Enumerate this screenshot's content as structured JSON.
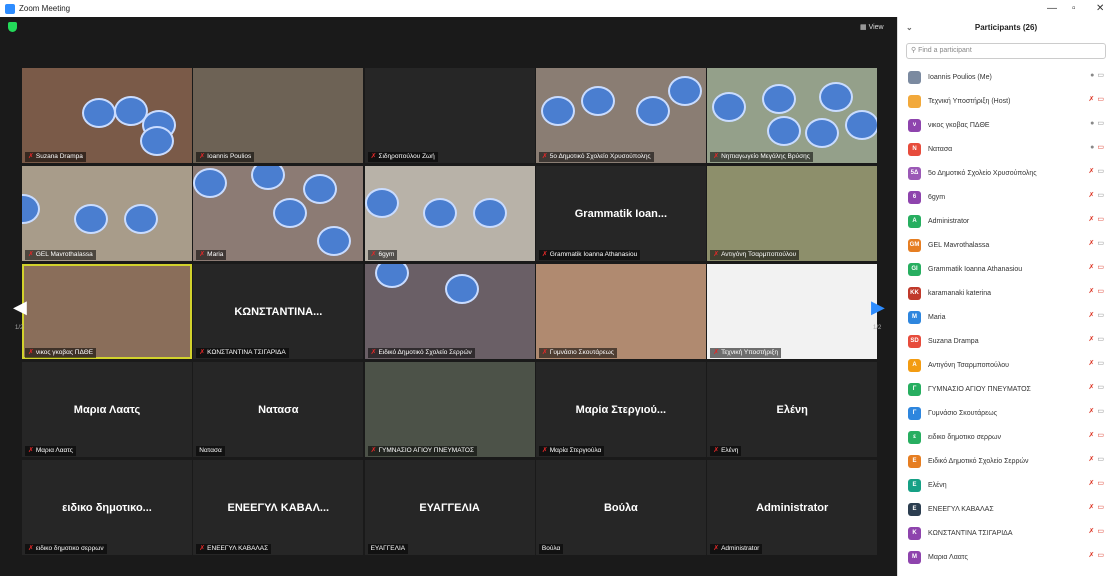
{
  "window": {
    "title": "Zoom Meeting",
    "minimize": "—",
    "maximize": "▫",
    "close": "✕"
  },
  "toolbar": {
    "view_label": "View"
  },
  "pager": {
    "left": "1/2",
    "right": "1/2"
  },
  "tiles": [
    {
      "name": "Suzana Drampa",
      "big": "",
      "video": true,
      "bg": "#7a5a48"
    },
    {
      "name": "Ioannis Poulios",
      "big": "",
      "video": true,
      "bg": "#6d6255"
    },
    {
      "name": "Σιδηροπούλου Ζωή",
      "big": "",
      "video": false,
      "bg": "#262626"
    },
    {
      "name": "5ο Δημοτικό Σχολείο Χρυσούπολης",
      "big": "",
      "video": true,
      "bg": "#8a7d73"
    },
    {
      "name": "Νηπιαγωγείο Μεγάλης Βρύσης",
      "big": "",
      "video": true,
      "bg": "#94a08a"
    },
    {
      "name": "GEL Mavrothalassa",
      "big": "",
      "video": true,
      "bg": "#a89c8a"
    },
    {
      "name": "Maria",
      "big": "",
      "video": true,
      "bg": "#8c7b74"
    },
    {
      "name": "6gym",
      "big": "",
      "video": true,
      "bg": "#b8b2a8"
    },
    {
      "name": "Grammatik Ioanna Athanasiou",
      "big": "Grammatik Ioan...",
      "video": false,
      "bg": "#262626"
    },
    {
      "name": "Αντιγόνη Τσαρμποπούλου",
      "big": "",
      "video": true,
      "bg": "#8d8f6b"
    },
    {
      "name": "νικος γκοβας ΠΔΘΕ",
      "big": "",
      "video": true,
      "bg": "#8a6e5a"
    },
    {
      "name": "ΚΩΝΣΤΑΝΤΙΝΑ ΤΣΙΓΑΡΙΔΑ",
      "big": "ΚΩΝΣΤΑΝΤΙΝΑ...",
      "video": false,
      "bg": "#262626"
    },
    {
      "name": "Ειδικό Δημοτικό Σχολείο Σερρών",
      "big": "",
      "video": true,
      "bg": "#6a5f66"
    },
    {
      "name": "Γυμνάσιο Σκουτάρεως",
      "big": "",
      "video": true,
      "bg": "#b08a70"
    },
    {
      "name": "Τεχνική Υποστήριξη",
      "big": "",
      "video": true,
      "bg": "#f2f2f2"
    },
    {
      "name": "Μαρια Λαατς",
      "big": "Μαρια Λαατς",
      "video": false,
      "bg": "#262626"
    },
    {
      "name": "Νατασα",
      "big": "Νατασα",
      "video": false,
      "bg": "#262626"
    },
    {
      "name": "ΓΥΜΝΑΣΙΟ ΑΓΙΟΥ ΠΝΕΥΜΑΤΟΣ",
      "big": "",
      "video": true,
      "bg": "#4c5248"
    },
    {
      "name": "Μαρία Στεργιούλα",
      "big": "Μαρία Στεργιού...",
      "video": false,
      "bg": "#262626"
    },
    {
      "name": "Ελένη",
      "big": "Ελένη",
      "video": false,
      "bg": "#262626"
    },
    {
      "name": "ειδικο δημοτικο σερρων",
      "big": "ειδικο δημοτικο...",
      "video": false,
      "bg": "#262626"
    },
    {
      "name": "ΕΝΕΕΓΥΛ ΚΑΒΑΛΑΣ",
      "big": "ΕΝΕΕΓΥΛ ΚΑΒΑΛ...",
      "video": false,
      "bg": "#262626"
    },
    {
      "name": "ΕΥΑΓΓΕΛΙΑ",
      "big": "ΕΥΑΓΓΕΛΙΑ",
      "video": false,
      "bg": "#262626"
    },
    {
      "name": "Βούλα",
      "big": "Βούλα",
      "video": false,
      "bg": "#262626"
    },
    {
      "name": "Administrator",
      "big": "Administrator",
      "video": false,
      "bg": "#262626"
    }
  ],
  "participants_panel": {
    "title": "Participants (26)",
    "search_placeholder": "Find a participant",
    "items": [
      {
        "name": "Ioannis Poulios (Me)",
        "initials": "",
        "color": "#7b8aa0",
        "muted": false,
        "video": true
      },
      {
        "name": "Τεχνική Υποστήριξη (Host)",
        "initials": "",
        "color": "#f2a93b",
        "muted": true,
        "video": false
      },
      {
        "name": "νικος γκοβας ΠΔΘΕ",
        "initials": "ν",
        "color": "#8e44ad",
        "muted": false,
        "video": true
      },
      {
        "name": "Νατασα",
        "initials": "N",
        "color": "#e74c3c",
        "muted": false,
        "video": false
      },
      {
        "name": "5ο Δημοτικό Σχολείο Χρυσούπολης",
        "initials": "5Δ",
        "color": "#9b59b6",
        "muted": true,
        "video": true
      },
      {
        "name": "6gym",
        "initials": "6",
        "color": "#8e44ad",
        "muted": true,
        "video": true
      },
      {
        "name": "Administrator",
        "initials": "A",
        "color": "#27ae60",
        "muted": true,
        "video": false
      },
      {
        "name": "GEL Mavrothalassa",
        "initials": "GM",
        "color": "#e67e22",
        "muted": true,
        "video": true
      },
      {
        "name": "Grammatik Ioanna Athanasiou",
        "initials": "GI",
        "color": "#27ae60",
        "muted": true,
        "video": false
      },
      {
        "name": "karamanaki katerina",
        "initials": "KK",
        "color": "#c0392b",
        "muted": true,
        "video": false
      },
      {
        "name": "Maria",
        "initials": "M",
        "color": "#2e86de",
        "muted": true,
        "video": true
      },
      {
        "name": "Suzana Drampa",
        "initials": "SD",
        "color": "#e74c3c",
        "muted": true,
        "video": true
      },
      {
        "name": "Αντιγόνη Τσαρμποπούλου",
        "initials": "A",
        "color": "#f39c12",
        "muted": true,
        "video": true
      },
      {
        "name": "ΓΥΜΝΑΣΙΟ ΑΓΙΟΥ ΠΝΕΥΜΑΤΟΣ",
        "initials": "Γ",
        "color": "#27ae60",
        "muted": true,
        "video": true
      },
      {
        "name": "Γυμνάσιο Σκουτάρεως",
        "initials": "Γ",
        "color": "#2e86de",
        "muted": true,
        "video": true
      },
      {
        "name": "ειδικο δημοτικο σερρων",
        "initials": "ε",
        "color": "#27ae60",
        "muted": true,
        "video": false
      },
      {
        "name": "Ειδικό Δημοτικό Σχολείο Σερρών",
        "initials": "E",
        "color": "#e67e22",
        "muted": true,
        "video": true
      },
      {
        "name": "Ελένη",
        "initials": "E",
        "color": "#16a085",
        "muted": true,
        "video": false
      },
      {
        "name": "ΕΝΕΕΓΥΛ ΚΑΒΑΛΑΣ",
        "initials": "E",
        "color": "#2c3e50",
        "muted": true,
        "video": false
      },
      {
        "name": "ΚΩΝΣΤΑΝΤΙΝΑ ΤΣΙΓΑΡΙΔΑ",
        "initials": "K",
        "color": "#8e44ad",
        "muted": true,
        "video": false
      },
      {
        "name": "Μαρια Λαατς",
        "initials": "M",
        "color": "#8e44ad",
        "muted": true,
        "video": false
      }
    ]
  }
}
